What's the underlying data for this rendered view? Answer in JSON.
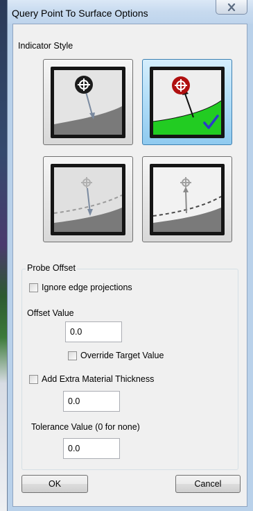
{
  "dialog": {
    "title": "Query Point To Surface Options",
    "close_glyph": "✕"
  },
  "indicator_style": {
    "label": "Indicator Style",
    "options": [
      {
        "icon": "probe-arrow-down-gray-surface-icon",
        "selected": false
      },
      {
        "icon": "probe-arrow-up-green-surface-check-icon",
        "selected": true
      },
      {
        "icon": "probe-pin-dashed-offset-gray-icon",
        "selected": false
      },
      {
        "icon": "probe-pin-dashed-offset-white-icon",
        "selected": false
      }
    ]
  },
  "probe_offset": {
    "group_label": "Probe Offset",
    "ignore_edge_label": "Ignore edge projections",
    "ignore_edge_checked": false,
    "offset_value_label": "Offset Value",
    "offset_value": "0.0",
    "override_target_label": "Override Target Value",
    "override_target_checked": false,
    "extra_material_label": "Add Extra Material Thickness",
    "extra_material_checked": false,
    "extra_material_value": "0.0",
    "tolerance_label": "Tolerance Value (0 for none)",
    "tolerance_value": "0.0"
  },
  "buttons": {
    "ok": "OK",
    "cancel": "Cancel"
  },
  "colors": {
    "accent_surface_green": "#22cc22",
    "probe_red": "#b01010",
    "selection_blue": "#8fcaef"
  }
}
